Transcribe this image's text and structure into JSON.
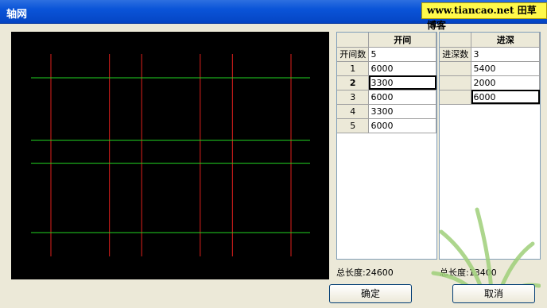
{
  "window": {
    "title": "轴网"
  },
  "watermark": {
    "text": "www.tiancao.net 田草博客"
  },
  "bay_table": {
    "header": "开间",
    "count_label": "开间数",
    "count_value": "5",
    "rows": [
      {
        "index": "1",
        "value": "6000"
      },
      {
        "index": "2",
        "value": "3300"
      },
      {
        "index": "3",
        "value": "6000"
      },
      {
        "index": "4",
        "value": "3300"
      },
      {
        "index": "5",
        "value": "6000"
      }
    ],
    "selected_row": 1
  },
  "depth_table": {
    "header": "进深",
    "count_label": "进深数",
    "count_value": "3",
    "rows": [
      {
        "index": "",
        "value": "5400"
      },
      {
        "index": "",
        "value": "2000"
      },
      {
        "index": "",
        "value": "6000"
      }
    ],
    "selected_row": 2
  },
  "totals": {
    "bay_total": "总长度:24600",
    "depth_total": "总长度:13400"
  },
  "buttons": {
    "ok": "确定",
    "cancel": "取消"
  },
  "preview": {
    "bay_spacings": [
      6000,
      3300,
      6000,
      3300,
      6000
    ],
    "depth_spacings": [
      5400,
      2000,
      6000
    ],
    "bay_line_color": "#e0201c",
    "depth_line_color": "#22d422",
    "background": "#000000"
  }
}
